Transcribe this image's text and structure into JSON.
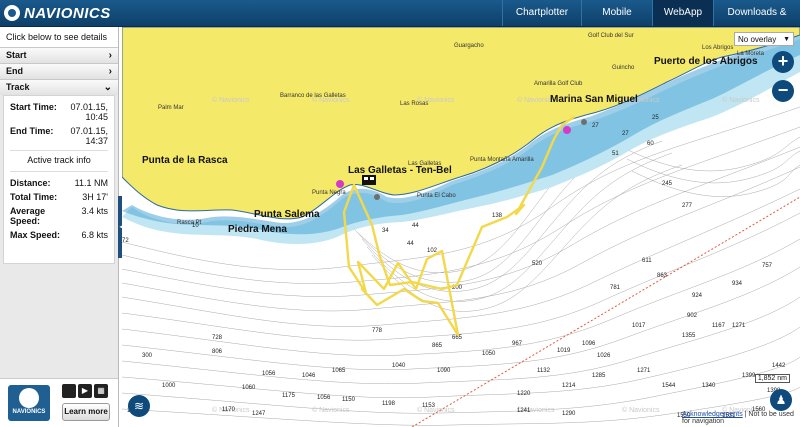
{
  "brand": {
    "name": "NAVIONICS"
  },
  "nav": {
    "items": [
      {
        "label": "Chartplotter",
        "width": 78
      },
      {
        "label": "Mobile",
        "width": 70
      },
      {
        "label": "WebApp",
        "width": 60,
        "active": true
      },
      {
        "label": "Downloads & Updates",
        "width": 86
      }
    ]
  },
  "sidebar": {
    "hint": "Click below to see details",
    "sections": [
      "Start",
      "End",
      "Track"
    ],
    "track": {
      "start_label": "Start Time:",
      "start_value_date": "07.01.15,",
      "start_value_time": "10:45",
      "end_label": "End Time:",
      "end_value_date": "07.01.15,",
      "end_value_time": "14:37",
      "active_info": "Active track info",
      "distance_label": "Distance:",
      "distance_value": "11.1 NM",
      "total_time_label": "Total Time:",
      "total_time_value": "3H 17'",
      "avg_speed_label": "Average Speed:",
      "avg_speed_value": "3.4 kts",
      "max_speed_label": "Max Speed:",
      "max_speed_value": "6.8 kts"
    },
    "badge_text": "NAVIONICS",
    "learn_more": "Learn more"
  },
  "map": {
    "overlay_select": "No overlay",
    "zoom_in": "+",
    "zoom_out": "−",
    "scale": "1,852 nm",
    "footer_link": "Acknowledgements",
    "footer_text": "| Not to be used for navigation",
    "places": {
      "puerto_abrigos": "Puerto de los Abrigos",
      "marina": "Marina San Miguel",
      "galletas": "Las Galletas - Ten-Bel",
      "rasca": "Punta de la Rasca",
      "salema": "Punta Salema",
      "piedra": "Piedra Mena",
      "guargacho": "Guargacho",
      "golf": "Golf Club del Sur",
      "amarilla": "Amarilla Golf Club",
      "palm": "Palm Mar",
      "barranco": "Barranco de las Galletas",
      "rosas": "Las Rosas",
      "lasgalletas": "Las Galletas",
      "montana": "Punta Montaña Amarilla",
      "negra": "Punta Negra",
      "elcabo": "Punta El Cabo",
      "guincho": "Guincho",
      "abrigos": "Los Abrigos",
      "moreta": "La Moreta",
      "rascapt": "Rasca Pt"
    }
  },
  "colors": {
    "land": "#f5e96a",
    "track": "#f3d84a",
    "nav": "#0d3f69"
  }
}
